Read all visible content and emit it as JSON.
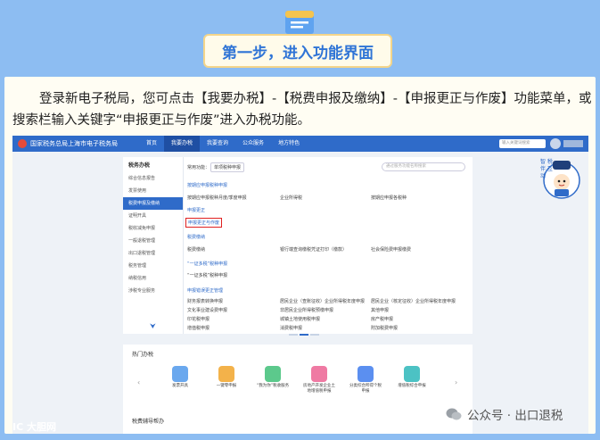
{
  "title": "第一步，进入功能界面",
  "intro": "登录新电子税局，您可点击【我要办税】-【税费申报及缴纳】-【申报更正与作废】功能菜单，或搜索栏输入关键字“申报更正与作废”进入办税功能。",
  "portal": {
    "site_name": "国家税务总局上海市电子税务局",
    "nav": [
      "首页",
      "我要办税",
      "我要查询",
      "公众服务",
      "地方特色"
    ],
    "search_placeholder": "输入关键词搜索",
    "sidebar_title": "税务办税",
    "sidebar_items": [
      "综合信息报告",
      "发票使用",
      "税费申报及缴纳",
      "证明开具",
      "税收减免申报",
      "一般退税管理",
      "出口退税管理",
      "税务管理",
      "纳税信用",
      "涉税专业服务"
    ],
    "active_sidebar_index": 2,
    "content_search_placeholder": "通过服务功能名称搜索",
    "common_label": "常用功能：",
    "common_chip": "单项税种申报",
    "sections": [
      {
        "title": "按期应申报税种申报",
        "items": [
          "按期应申报税种月度/季度申报",
          "企业所得税",
          "按期应申报各税种"
        ]
      },
      {
        "title": "申报更正",
        "items": [
          "申报更正与作废"
        ]
      },
      {
        "title": "税费缴纳",
        "items": [
          "税费缴纳",
          "银行端查询缴税凭证打印（缴款）",
          "社会保险费申报缴费"
        ]
      },
      {
        "title": "“一证多税”税种申报",
        "items": [
          "“一证多税”税种申报"
        ]
      },
      {
        "title": "申报错误更正管理",
        "items": [
          "财务报表转换申报",
          "居民企业（查账征收）企业所得税年度申报",
          "居民企业（核定征收）企业所得税年度申报",
          "文化事业建设费申报",
          "非居民企业所得税预缴申报",
          "其他申报",
          "印花税申报",
          "城镇土地使用税申报",
          "房产税申报",
          "增值税申报",
          "消费税申报",
          "附加税费申报"
        ]
      }
    ],
    "highlighted_item": "申报更正与作废",
    "lower_title": "热门办税",
    "lower_tiles": [
      "发票开具",
      "一键零申报",
      "“我为你”税收服务",
      "房地产开发企业土地增值税申报",
      "分类综合所得个税申报",
      "增值税综合申报"
    ],
    "lower2_title": "税费辅导帮办",
    "mascot_text": "智 税 伴 互 动"
  },
  "watermark_left": "IC 大胆网",
  "watermark_right": "公众号 · 出口退税",
  "colors": {
    "background": "#8dbdf2",
    "title_text": "#2f74d6",
    "portal_blue": "#2f6bc9",
    "highlight": "#e02020"
  }
}
